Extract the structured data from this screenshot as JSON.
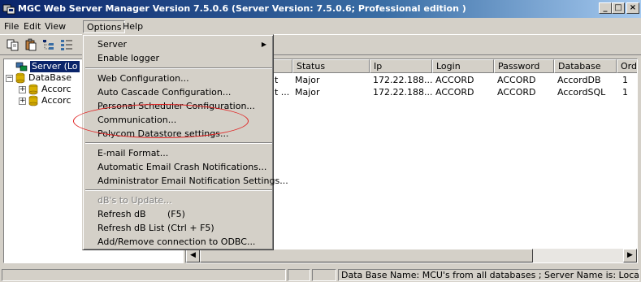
{
  "window": {
    "title": "MGC Web Server Manager Version 7.5.0.6 (Server Version: 7.5.0.6;  Professional edition )",
    "minimize_label": "_",
    "maximize_label": "□",
    "close_label": "×"
  },
  "menubar": [
    "File",
    "Edit",
    "View",
    "Options",
    "Help"
  ],
  "tree": {
    "root_label": "Server (Lo",
    "database_label": "DataBase",
    "children": [
      "Accorc",
      "Accorc"
    ]
  },
  "table": {
    "columns": [
      "Status",
      "Ip",
      "Login",
      "Password",
      "Database",
      "Orde"
    ],
    "rows": [
      {
        "lead": "t",
        "status": "Major",
        "ip": "172.22.188...",
        "login": "ACCORD",
        "password": "ACCORD",
        "database": "AccordDB",
        "order": "1"
      },
      {
        "lead": "t ...",
        "status": "Major",
        "ip": "172.22.188...",
        "login": "ACCORD",
        "password": "ACCORD",
        "database": "AccordSQL",
        "order": "1"
      }
    ]
  },
  "options_menu": {
    "server": "Server",
    "enable_logger": "Enable logger",
    "web_configuration": "Web Configuration...",
    "auto_cascade": "Auto Cascade Configuration...",
    "personal_scheduler": "Personal Scheduler Configuration...",
    "communication": "Communication...",
    "polycom_datastore": "Polycom Datastore settings...",
    "email_format": "E-mail Format...",
    "crash_notifications": "Automatic Email Crash  Notifications...",
    "admin_email": "Administrator Email Notification Settings...",
    "dbs_to_update": "dB's to Update...",
    "refresh_db": "Refresh dB",
    "refresh_db_shortcut": "(F5)",
    "refresh_db_list": "Refresh dB List",
    "refresh_db_list_shortcut": "(Ctrl + F5)",
    "add_remove_odbc": "Add/Remove connection to ODBC..."
  },
  "statusbar": {
    "info": "Data Base Name: MCU's from all databases ; Server Name is: LocalHost"
  },
  "colors": {
    "title_gradient_start": "#0a246a",
    "face": "#d4d0c8",
    "selection": "#0a246a",
    "annotation": "#e02020"
  },
  "icons": [
    "app-icon",
    "copy-icon",
    "paste-icon",
    "tree-view-icon",
    "server-icon",
    "database-icon",
    "submenu-arrow-icon"
  ]
}
